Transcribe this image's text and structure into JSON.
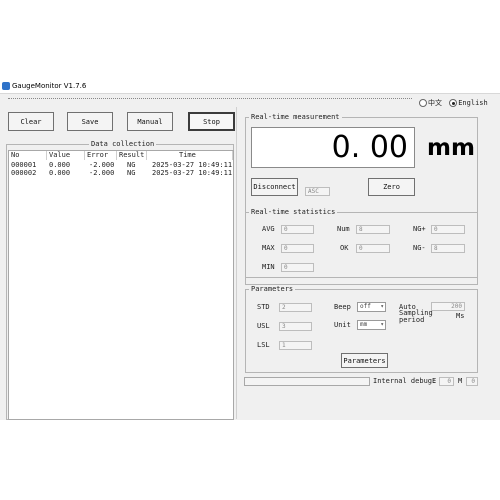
{
  "window": {
    "title": "GaugeMonitor V1.7.6"
  },
  "language": {
    "option_cn": "中文",
    "option_en": "English",
    "selected": "English"
  },
  "toolbar": {
    "clear": "Clear",
    "save": "Save",
    "manual": "Manual",
    "stop": "Stop"
  },
  "data_collection": {
    "title": "Data collection",
    "columns": [
      "No",
      "Value",
      "Error",
      "Result",
      "Time"
    ],
    "rows": [
      [
        "000001",
        "0.000",
        "-2.000",
        "NG",
        "2025-03-27 10:49:11"
      ],
      [
        "000002",
        "0.000",
        "-2.000",
        "NG",
        "2025-03-27 10:49:11"
      ]
    ]
  },
  "realtime": {
    "title": "Real-time measurement",
    "value": "0. 00",
    "unit": "mm",
    "disconnect": "Disconnect",
    "mode": "ASC",
    "zero": "Zero"
  },
  "stats": {
    "title": "Real-time statistics",
    "avg_label": "AVG",
    "avg_value": "0",
    "num_label": "Num",
    "num_value": "8",
    "ngp_label": "NG+",
    "ngp_value": "0",
    "max_label": "MAX",
    "max_value": "0",
    "ok_label": "OK",
    "ok_value": "0",
    "ngm_label": "NG-",
    "ngm_value": "8",
    "min_label": "MIN",
    "min_value": "0"
  },
  "params": {
    "title": "Parameters",
    "std_label": "STD",
    "std_value": "2",
    "usl_label": "USL",
    "usl_value": "3",
    "lsl_label": "LSL",
    "lsl_value": "1",
    "beep_label": "Beep",
    "beep_value": "off",
    "unit_label": "Unit",
    "unit_value": "mm",
    "auto_label": "Auto",
    "auto_value": "200",
    "sampling_label": "Sampling",
    "period_label": "period",
    "ms_label": "Ms",
    "button": "Parameters"
  },
  "debug": {
    "label": "Internal debug:",
    "e_label": "E",
    "e_value": "0",
    "m_label": "M",
    "m_value": "0"
  }
}
